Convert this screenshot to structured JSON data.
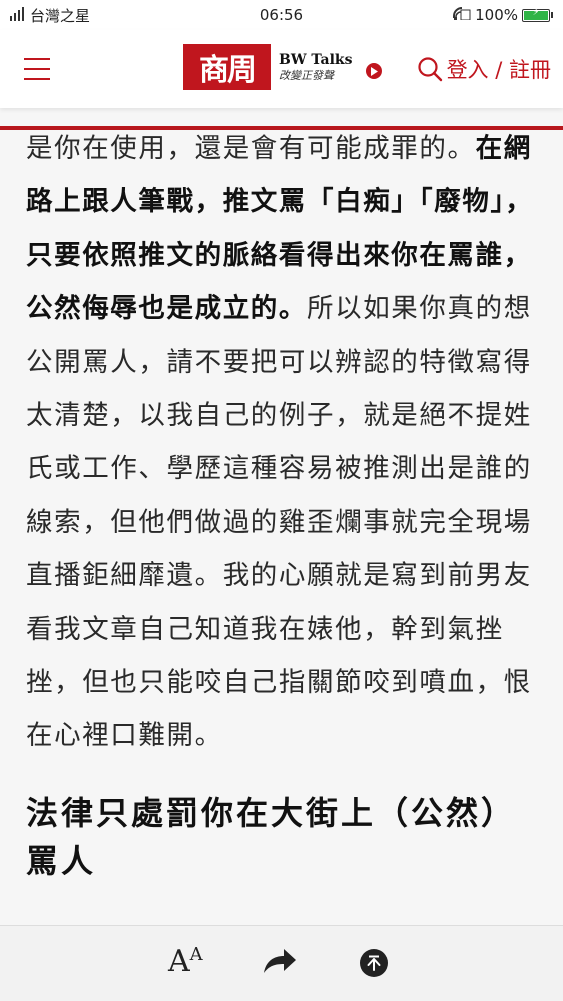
{
  "status_bar": {
    "carrier": "台灣之星",
    "time": "06:56",
    "battery": "100%",
    "battery_level": 1.0
  },
  "header": {
    "logo_text": "商周",
    "bw_talks": "BW Talks",
    "bw_slogan": "改變正發聲",
    "login_label": "登入 / 註冊"
  },
  "article": {
    "p1_a": "是你在使用，還是會有可能成罪的。",
    "p1_b": "在網路上跟人筆戰，推文罵「白痴」「廢物」，只要依照推文的脈絡看得出來你在罵誰，公然侮辱也是成立的。",
    "p1_c": "所以如果你真的想公開罵人，請不要把可以辨認的特徵寫得太清楚，以我自己的例子，就是絕不提姓氏或工作、學歷這種容易被推測出是誰的線索，但他們做過的雞歪爛事就完全現場直播鉅細靡遺。我的心願就是寫到前男友看我文章自己知道我在婊他，幹到氣挫挫，但也只能咬自己指關節咬到噴血，恨在心裡口難開。",
    "heading": "法律只處罰你在大街上（公然）罵人"
  },
  "bottom_bar": {
    "font_label_big": "A",
    "font_label_small": "A"
  },
  "colors": {
    "brand_red": "#c0161e",
    "battery_green": "#2fb446"
  },
  "icons": [
    "menu-icon",
    "play-icon",
    "search-icon",
    "font-size-icon",
    "share-icon",
    "back-to-top-icon",
    "wifi-icon",
    "signal-icon",
    "battery-icon"
  ]
}
